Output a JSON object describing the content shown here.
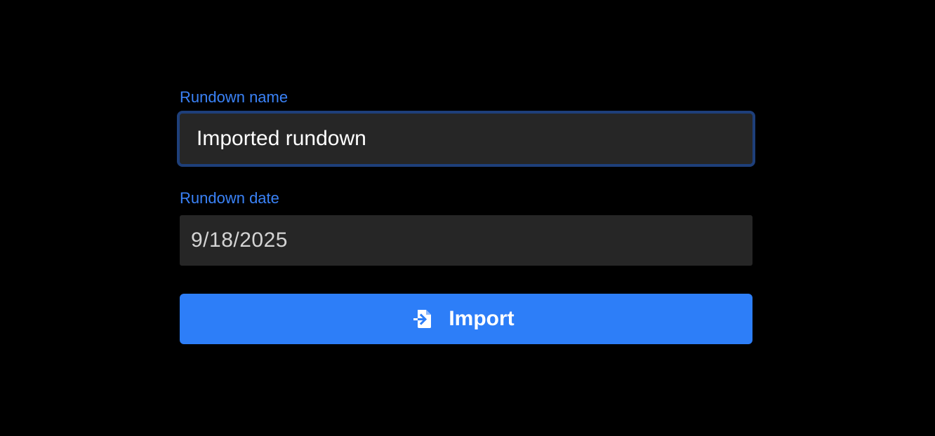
{
  "form": {
    "name_label": "Rundown name",
    "name_value": "Imported rundown",
    "date_label": "Rundown date",
    "date_value": "9/18/2025",
    "import_button": {
      "label": "Import",
      "icon": "file-import-icon"
    }
  },
  "colors": {
    "background": "#000000",
    "label": "#3a82f7",
    "input_background": "#262626",
    "focus_border": "#1e3f7a",
    "button": "#2d7ef8"
  }
}
